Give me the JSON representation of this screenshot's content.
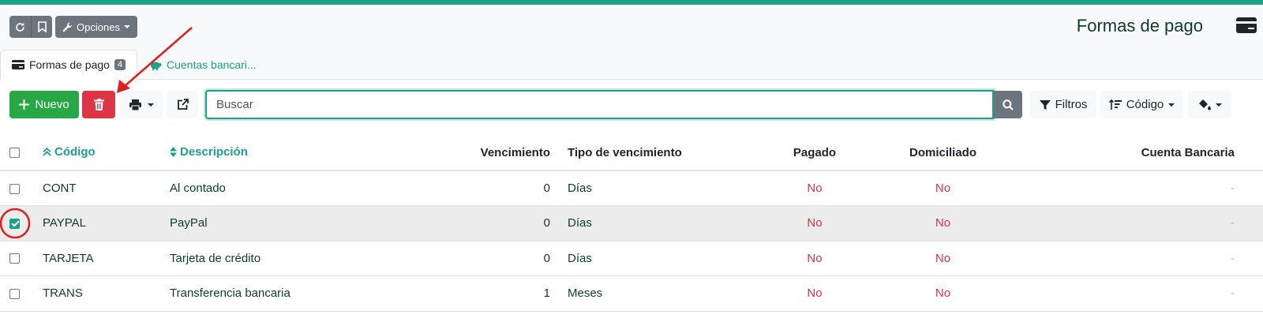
{
  "colors": {
    "accent": "#1aa385",
    "success": "#28a745",
    "danger": "#dc3545",
    "secondary": "#6c757d",
    "warning": "#f0ad4e",
    "annotation": "#e02020"
  },
  "toolbar": {
    "options_label": "Opciones"
  },
  "page": {
    "title": "Formas de pago"
  },
  "tabs": [
    {
      "label": "Formas de pago",
      "badge": "4",
      "active": true,
      "icon": "credit-card-icon"
    },
    {
      "label": "Cuentas bancari...",
      "active": false,
      "icon": "piggy-bank-icon"
    }
  ],
  "actions": {
    "new_label": "Nuevo",
    "search_placeholder": "Buscar",
    "filters_label": "Filtros",
    "order_label": "Código"
  },
  "table": {
    "headers": {
      "code": "Código",
      "description": "Descripción",
      "due": "Vencimiento",
      "due_type": "Tipo de vencimiento",
      "paid": "Pagado",
      "direct_debit": "Domiciliado",
      "bank_account": "Cuenta Bancaria"
    },
    "rows": [
      {
        "checked": false,
        "code": "CONT",
        "description": "Al contado",
        "due": "0",
        "due_type": "Días",
        "paid": "No",
        "direct_debit": "No",
        "bank_account": "-"
      },
      {
        "checked": true,
        "code": "PAYPAL",
        "description": "PayPal",
        "due": "0",
        "due_type": "Días",
        "paid": "No",
        "direct_debit": "No",
        "bank_account": "-"
      },
      {
        "checked": false,
        "code": "TARJETA",
        "description": "Tarjeta de crédito",
        "due": "0",
        "due_type": "Días",
        "paid": "No",
        "direct_debit": "No",
        "bank_account": "-"
      },
      {
        "checked": false,
        "code": "TRANS",
        "description": "Transferencia bancaria",
        "due": "1",
        "due_type": "Meses",
        "paid": "No",
        "direct_debit": "No",
        "bank_account": "-"
      }
    ]
  }
}
